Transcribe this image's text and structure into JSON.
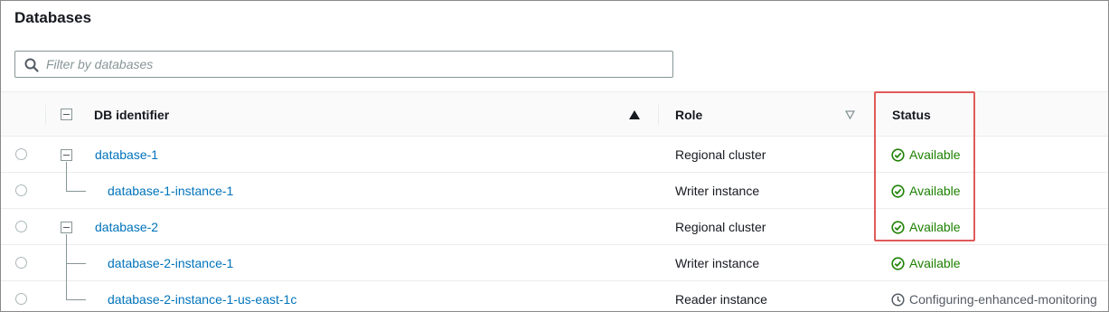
{
  "header": {
    "title": "Databases"
  },
  "filter": {
    "placeholder": "Filter by databases",
    "value": ""
  },
  "columns": {
    "identifier": "DB identifier",
    "role": "Role",
    "status": "Status"
  },
  "rows": [
    {
      "identifier": "database-1",
      "role": "Regional cluster",
      "status": "Available",
      "level": 0,
      "status_type": "available"
    },
    {
      "identifier": "database-1-instance-1",
      "role": "Writer instance",
      "status": "Available",
      "level": 1,
      "status_type": "available"
    },
    {
      "identifier": "database-2",
      "role": "Regional cluster",
      "status": "Available",
      "level": 0,
      "status_type": "available"
    },
    {
      "identifier": "database-2-instance-1",
      "role": "Writer instance",
      "status": "Available",
      "level": 1,
      "status_type": "available"
    },
    {
      "identifier": "database-2-instance-1-us-east-1c",
      "role": "Reader instance",
      "status": "Configuring-enhanced-monitoring",
      "level": 1,
      "status_type": "configuring"
    }
  ],
  "colors": {
    "link": "#0073bb",
    "available": "#1d8102",
    "neutral": "#545b64",
    "highlight": "#e05a5a"
  }
}
